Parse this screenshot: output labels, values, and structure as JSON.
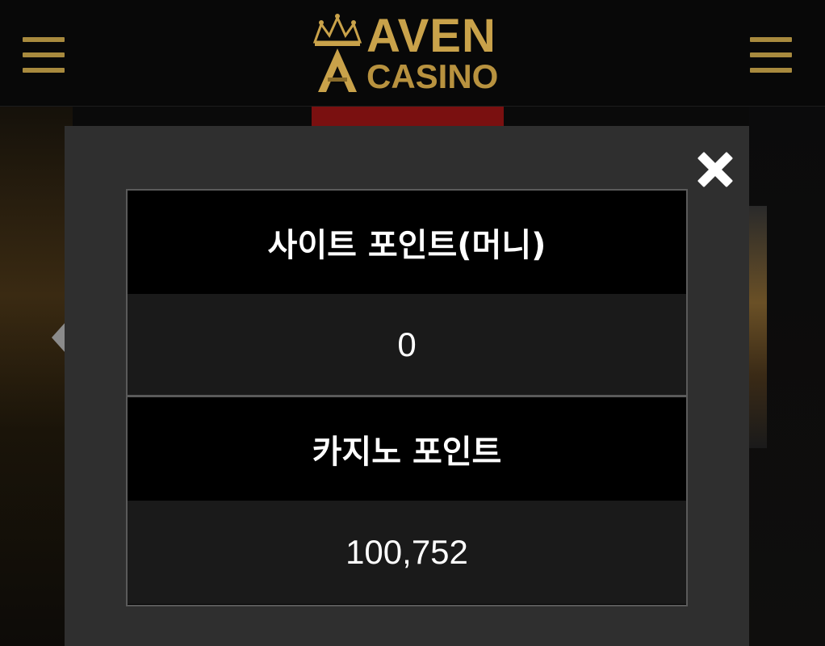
{
  "header": {
    "logo_line1": "AVEN",
    "logo_line2": "CASINO",
    "menu_left_icon": "hamburger-menu-icon",
    "menu_right_icon": "hamburger-menu-icon"
  },
  "colors": {
    "gold": "#c9a24a",
    "modal_bg": "#2f2f2f",
    "title_bg": "#000000",
    "value_bg": "#1a1a1a",
    "accent_red": "#7a1010"
  },
  "modal": {
    "close_icon": "close-x-icon",
    "sections": [
      {
        "title": "사이트 포인트(머니)",
        "value": "0"
      },
      {
        "title": "카지노 포인트",
        "value": "100,752"
      }
    ]
  }
}
